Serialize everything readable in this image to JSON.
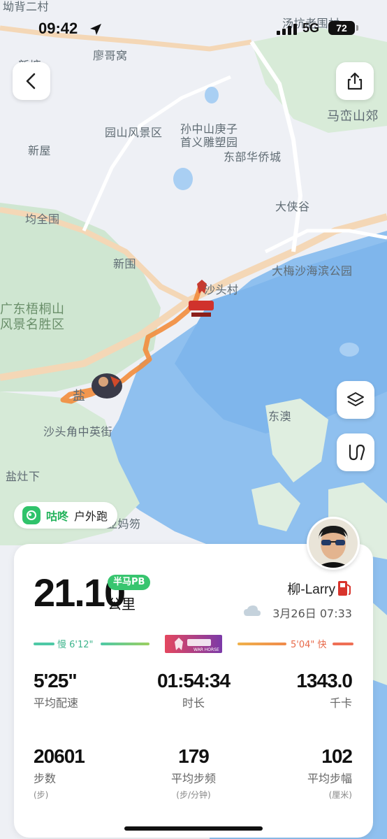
{
  "status_bar": {
    "time": "09:42",
    "network": "5G",
    "battery": "72"
  },
  "map": {
    "labels": [
      {
        "id": "l1",
        "text": "坳背二村"
      },
      {
        "id": "l2",
        "text": "廖哥窝"
      },
      {
        "id": "l3",
        "text": "汤坑老围村"
      },
      {
        "id": "l4",
        "text": "新塘"
      },
      {
        "id": "l5",
        "text": "园山风景区"
      },
      {
        "id": "l6",
        "text": "孙中山庚子"
      },
      {
        "id": "l7",
        "text": "首义雕塑园"
      },
      {
        "id": "l8",
        "text": "马峦山郊"
      },
      {
        "id": "l9",
        "text": "新屋"
      },
      {
        "id": "l10",
        "text": "东部华侨城"
      },
      {
        "id": "l11",
        "text": "大侠谷"
      },
      {
        "id": "l12",
        "text": "均全围"
      },
      {
        "id": "l13",
        "text": "新围"
      },
      {
        "id": "l14",
        "text": "大梅沙海滨公园"
      },
      {
        "id": "l15",
        "text": "沙头村"
      },
      {
        "id": "l16",
        "text": "广东梧桐山"
      },
      {
        "id": "l17",
        "text": "风景名胜区"
      },
      {
        "id": "l18",
        "text": "盐"
      },
      {
        "id": "l19",
        "text": "东澳"
      },
      {
        "id": "l20",
        "text": "沙头角中英街"
      },
      {
        "id": "l21",
        "text": "盐灶下"
      },
      {
        "id": "l22",
        "text": "亚妈笏"
      }
    ],
    "route_color": "#f28c3c"
  },
  "buttons": {
    "back": "back",
    "share": "share",
    "layers": "layers",
    "route": "route"
  },
  "app_tag": {
    "name": "咕咚",
    "activity": "户外跑"
  },
  "summary": {
    "distance": "21.10",
    "badge": "半马PB",
    "unit": "公里",
    "user_name": "柳-Larry",
    "datetime": "3月26日 07:33"
  },
  "pace_legend": {
    "slow": "慢 6'12\"",
    "fast": "5'04\" 快",
    "logo_text": "WAR HORSE"
  },
  "stats": [
    {
      "value": "5'25\"",
      "label": "平均配速",
      "sub": ""
    },
    {
      "value": "01:54:34",
      "label": "时长",
      "sub": ""
    },
    {
      "value": "1343.0",
      "label": "千卡",
      "sub": ""
    },
    {
      "value": "20601",
      "label": "步数",
      "sub": "(步)"
    },
    {
      "value": "179",
      "label": "平均步频",
      "sub": "(步/分钟)"
    },
    {
      "value": "102",
      "label": "平均步幅",
      "sub": "(厘米)"
    }
  ],
  "colors": {
    "accent_green": "#38c56f",
    "pace_slow": "#4ec9a6",
    "pace_fast": "#ef6f55"
  }
}
